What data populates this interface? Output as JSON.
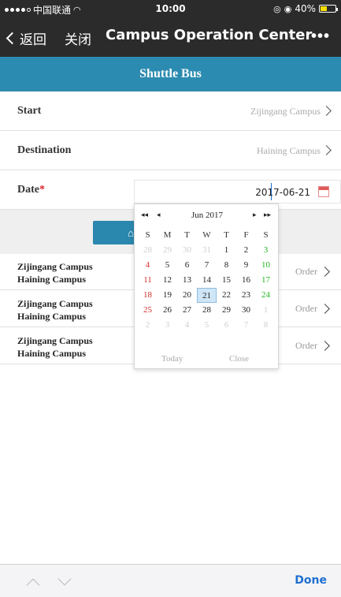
{
  "status_bar": {
    "carrier": "中国联通",
    "wifi": "wifi-icon",
    "time": "10:00",
    "battery_text": "40%",
    "battery_level": 0.4
  },
  "wechat_nav": {
    "back_label": "返回",
    "close_label": "关闭",
    "title": "Campus Operation Center",
    "more": "•••"
  },
  "page": {
    "title": "Shuttle Bus"
  },
  "form": {
    "start": {
      "label": "Start",
      "value": "Zijingang Campus"
    },
    "destination": {
      "label": "Destination",
      "value": "Haining Campus"
    },
    "date": {
      "label": "Date",
      "required_mark": "*",
      "value": "2017-06-21"
    }
  },
  "calendar": {
    "month_label": "Jun 2017",
    "prev_year": "◂◂",
    "prev_month": "◂",
    "next_month": "▸",
    "next_year": "▸▸",
    "weekdays": [
      "S",
      "M",
      "T",
      "W",
      "T",
      "F",
      "S"
    ],
    "weeks": [
      [
        "28",
        "29",
        "30",
        "31",
        "1",
        "2",
        "3"
      ],
      [
        "4",
        "5",
        "6",
        "7",
        "8",
        "9",
        "10"
      ],
      [
        "11",
        "12",
        "13",
        "14",
        "15",
        "16",
        "17"
      ],
      [
        "18",
        "19",
        "20",
        "21",
        "22",
        "23",
        "24"
      ],
      [
        "25",
        "26",
        "27",
        "28",
        "29",
        "30",
        "1"
      ],
      [
        "2",
        "3",
        "4",
        "5",
        "6",
        "7",
        "8"
      ]
    ],
    "selected_day": "21",
    "today_label": "Today",
    "close_label": "Close"
  },
  "routes": [
    {
      "from": "Zijingang Campus",
      "to": "Haining Campus",
      "action": "Order"
    },
    {
      "from": "Zijingang Campus",
      "to": "Haining Campus",
      "action": "Order"
    },
    {
      "from": "Zijingang Campus",
      "to": "Haining Campus",
      "action": "Order"
    }
  ],
  "toolbar": {
    "done_label": "Done"
  },
  "colors": {
    "header_bg": "#2c8bb0",
    "nav_bg": "#2b2b2b",
    "done_text": "#1f6fd1"
  }
}
